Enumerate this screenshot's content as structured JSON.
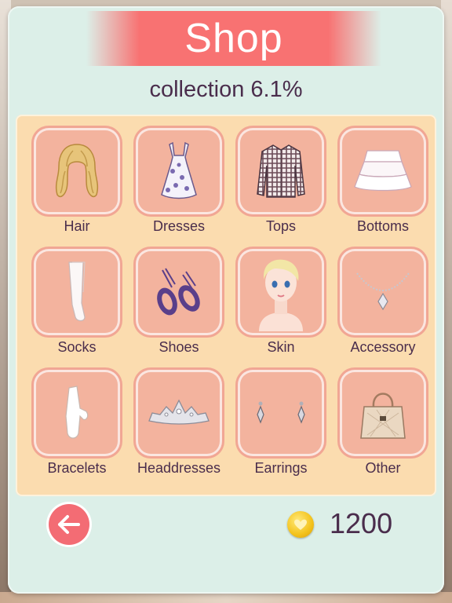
{
  "header": {
    "title": "Shop"
  },
  "collection_text": "collection 6.1%",
  "categories": [
    {
      "label": "Hair",
      "icon": "hair-icon"
    },
    {
      "label": "Dresses",
      "icon": "dress-icon"
    },
    {
      "label": "Tops",
      "icon": "shirt-icon"
    },
    {
      "label": "Bottoms",
      "icon": "skirt-icon"
    },
    {
      "label": "Socks",
      "icon": "socks-icon"
    },
    {
      "label": "Shoes",
      "icon": "shoes-icon"
    },
    {
      "label": "Skin",
      "icon": "face-icon"
    },
    {
      "label": "Accessory",
      "icon": "necklace-icon"
    },
    {
      "label": "Bracelets",
      "icon": "glove-icon"
    },
    {
      "label": "Headdresses",
      "icon": "tiara-icon"
    },
    {
      "label": "Earrings",
      "icon": "earrings-icon"
    },
    {
      "label": "Other",
      "icon": "handbag-icon"
    }
  ],
  "footer": {
    "back_icon": "arrow-left-icon",
    "coin_icon": "coin-icon",
    "coins": "1200"
  },
  "colors": {
    "banner": "#f87272",
    "panel": "#dcefe8",
    "grid": "#fbdcaf",
    "tile": "#f3b39e",
    "text": "#4a2d4c",
    "back_button": "#f36c74"
  }
}
